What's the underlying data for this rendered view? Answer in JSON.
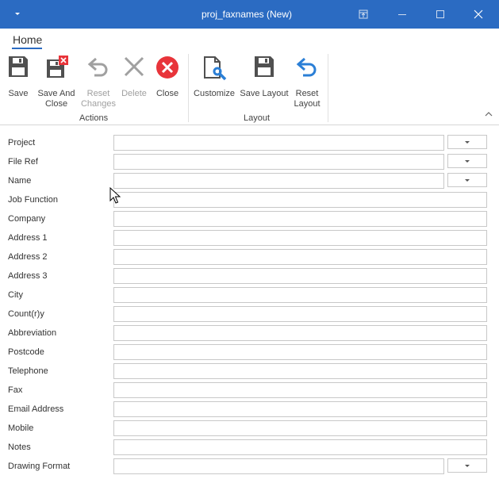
{
  "window": {
    "title": "proj_faxnames (New)"
  },
  "ribbon": {
    "tab_home": "Home",
    "buttons": {
      "save": "Save",
      "save_and_close": "Save And\nClose",
      "reset_changes": "Reset\nChanges",
      "delete": "Delete",
      "close": "Close",
      "customize": "Customize",
      "save_layout": "Save Layout",
      "reset_layout": "Reset\nLayout"
    },
    "groups": {
      "actions": "Actions",
      "layout": "Layout"
    }
  },
  "form": {
    "fields": [
      {
        "label": "Project",
        "value": "",
        "has_dropdown": true
      },
      {
        "label": "File Ref",
        "value": "",
        "has_dropdown": true
      },
      {
        "label": "Name",
        "value": "",
        "has_dropdown": true
      },
      {
        "label": "Job Function",
        "value": "",
        "has_dropdown": false
      },
      {
        "label": "Company",
        "value": "",
        "has_dropdown": false
      },
      {
        "label": "Address 1",
        "value": "",
        "has_dropdown": false
      },
      {
        "label": "Address 2",
        "value": "",
        "has_dropdown": false
      },
      {
        "label": "Address 3",
        "value": "",
        "has_dropdown": false
      },
      {
        "label": "City",
        "value": "",
        "has_dropdown": false
      },
      {
        "label": "Count(r)y",
        "value": "",
        "has_dropdown": false
      },
      {
        "label": "Abbreviation",
        "value": "",
        "has_dropdown": false
      },
      {
        "label": "Postcode",
        "value": "",
        "has_dropdown": false
      },
      {
        "label": "Telephone",
        "value": "",
        "has_dropdown": false
      },
      {
        "label": "Fax",
        "value": "",
        "has_dropdown": false
      },
      {
        "label": "Email Address",
        "value": "",
        "has_dropdown": false
      },
      {
        "label": "Mobile",
        "value": "",
        "has_dropdown": false
      },
      {
        "label": "Notes",
        "value": "",
        "has_dropdown": false
      },
      {
        "label": "Drawing Format",
        "value": "",
        "has_dropdown": true
      }
    ]
  },
  "colors": {
    "titlebar": "#2b6bc2",
    "accent": "#2b6bc2",
    "close_red": "#e8343a",
    "icon_gray": "#505050",
    "icon_disabled": "#a0a0a0"
  },
  "icons": {
    "save": "floppy-disk-icon",
    "save_and_close": "floppy-disk-x-icon",
    "reset_changes": "undo-icon",
    "delete": "x-icon",
    "close": "close-circle-icon",
    "customize": "document-wrench-icon",
    "save_layout": "floppy-disk-icon",
    "reset_layout": "undo-icon"
  }
}
